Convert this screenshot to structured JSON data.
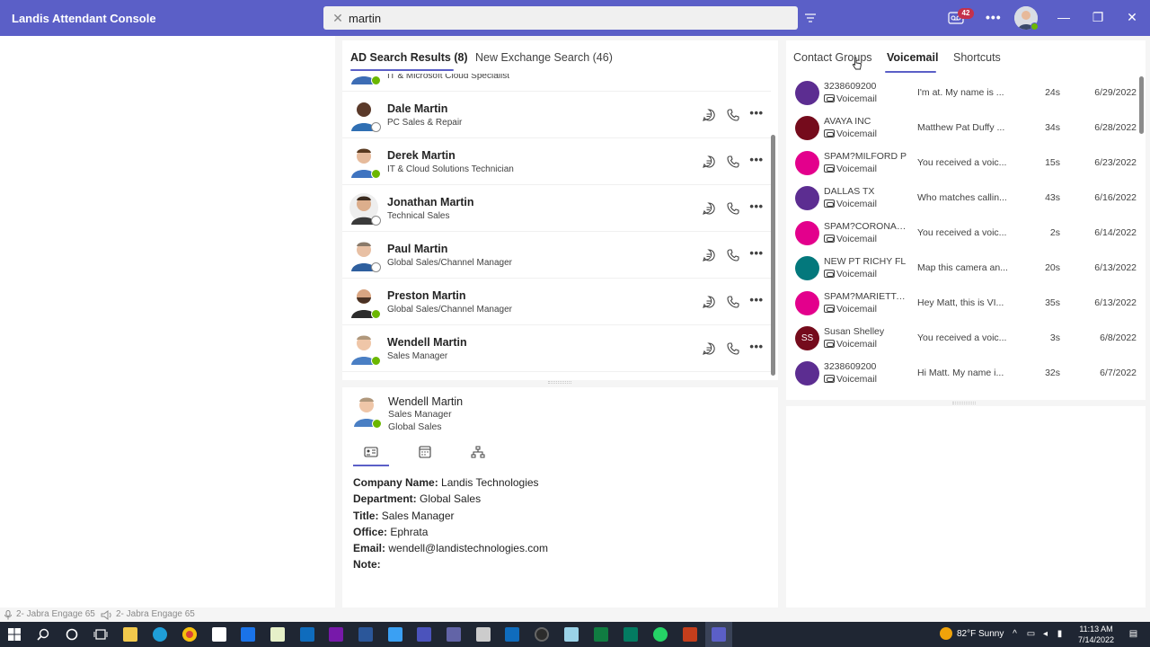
{
  "app": {
    "title": "Landis Attendant Console"
  },
  "search": {
    "value": "martin",
    "clear_label": "✕"
  },
  "header": {
    "voicemail_count": "42",
    "more_label": "•••"
  },
  "window": {
    "minimize": "—",
    "maximize": "❐",
    "close": "✕"
  },
  "center": {
    "tabs": [
      {
        "label": "AD Search Results (8)",
        "active": true
      },
      {
        "label": "New Exchange Search (46)",
        "active": false
      }
    ],
    "partial_contact": {
      "title": "IT & Microsoft Cloud Specialist"
    },
    "contacts": [
      {
        "name": "Dale Martin",
        "title": "PC Sales & Repair",
        "status": "offline"
      },
      {
        "name": "Derek Martin",
        "title": "IT & Cloud Solutions Technician",
        "status": "online"
      },
      {
        "name": "Jonathan Martin",
        "title": "Technical Sales",
        "status": "offline"
      },
      {
        "name": "Paul Martin",
        "title": "Global Sales/Channel Manager",
        "status": "offline"
      },
      {
        "name": "Preston Martin",
        "title": "Global Sales/Channel Manager",
        "status": "online"
      },
      {
        "name": "Wendell Martin",
        "title": "Sales Manager",
        "status": "online"
      }
    ],
    "more_label": "•••"
  },
  "detail": {
    "name": "Wendell Martin",
    "title": "Sales Manager",
    "department": "Global Sales",
    "fields": [
      {
        "label": "Company Name:",
        "value": "Landis Technologies"
      },
      {
        "label": "Department:",
        "value": "Global Sales"
      },
      {
        "label": "Title:",
        "value": "Sales Manager"
      },
      {
        "label": "Office:",
        "value": "Ephrata"
      },
      {
        "label": "Email:",
        "value": "wendell@landistechnologies.com"
      },
      {
        "label": "Note:",
        "value": ""
      }
    ]
  },
  "right": {
    "tabs": [
      {
        "label": "Contact Groups",
        "active": false
      },
      {
        "label": "Voicemail",
        "active": true
      },
      {
        "label": "Shortcuts",
        "active": false
      }
    ],
    "voicemails": [
      {
        "caller": "3238609200",
        "type": "Voicemail",
        "snippet": "I'm at. My name is ...",
        "duration": "24s",
        "date": "6/29/2022",
        "color": "#5c2d91",
        "initials": ""
      },
      {
        "caller": "AVAYA INC",
        "type": "Voicemail",
        "snippet": "Matthew Pat Duffy ...",
        "duration": "34s",
        "date": "6/28/2022",
        "color": "#750b1c",
        "initials": ""
      },
      {
        "caller": "SPAM?MILFORD P",
        "type": "Voicemail",
        "snippet": "You received a voic...",
        "duration": "15s",
        "date": "6/23/2022",
        "color": "#e3008c",
        "initials": ""
      },
      {
        "caller": "DALLAS TX",
        "type": "Voicemail",
        "snippet": "Who matches callin...",
        "duration": "43s",
        "date": "6/16/2022",
        "color": "#5c2d91",
        "initials": ""
      },
      {
        "caller": "SPAM?CORONAD...",
        "type": "Voicemail",
        "snippet": "You received a voic...",
        "duration": "2s",
        "date": "6/14/2022",
        "color": "#e3008c",
        "initials": ""
      },
      {
        "caller": "NEW PT RICHY FL",
        "type": "Voicemail",
        "snippet": "Map this camera an...",
        "duration": "20s",
        "date": "6/13/2022",
        "color": "#03787c",
        "initials": ""
      },
      {
        "caller": "SPAM?MARIETTA G",
        "type": "Voicemail",
        "snippet": "Hey Matt, this is VI...",
        "duration": "35s",
        "date": "6/13/2022",
        "color": "#e3008c",
        "initials": ""
      },
      {
        "caller": "Susan Shelley",
        "type": "Voicemail",
        "snippet": "You received a voic...",
        "duration": "3s",
        "date": "6/8/2022",
        "color": "#750b1c",
        "initials": "SS"
      },
      {
        "caller": "3238609200",
        "type": "Voicemail",
        "snippet": "Hi Matt. My name i...",
        "duration": "32s",
        "date": "6/7/2022",
        "color": "#5c2d91",
        "initials": ""
      }
    ]
  },
  "statusbar": {
    "mic": "2- Jabra Engage 65",
    "speaker": "2- Jabra Engage 65"
  },
  "taskbar": {
    "weather": "82°F  Sunny",
    "time": "11:13 AM",
    "date": "7/14/2022"
  },
  "colors": {
    "brand": "#5b5fc7",
    "online": "#6bb700",
    "badge": "#c4314b"
  }
}
